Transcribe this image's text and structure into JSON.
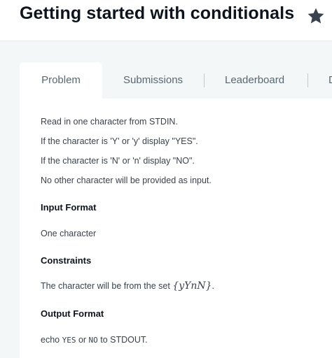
{
  "header": {
    "title": "Getting started with conditionals",
    "icon": "star-icon"
  },
  "tabs": [
    {
      "label": "Problem",
      "active": true
    },
    {
      "label": "Submissions",
      "active": false
    },
    {
      "label": "Leaderboard",
      "active": false
    },
    {
      "label": "D",
      "active": false
    }
  ],
  "problem": {
    "statement": [
      "Read in one character from STDIN.",
      "If the character is 'Y' or 'y' display \"YES\".",
      "If the character is 'N' or 'n' display \"NO\".",
      "No other character will be provided as input."
    ],
    "input_format": {
      "heading": "Input Format",
      "text": "One character"
    },
    "constraints": {
      "heading": "Constraints",
      "text_prefix": "The character will be from the set ",
      "set_open": "{",
      "set_body": "yYnN",
      "set_close": "}",
      "text_suffix": "."
    },
    "output_format": {
      "heading": "Output Format",
      "prefix": "echo ",
      "code1": "YES",
      "middle": " or ",
      "code2": "NO",
      "suffix": " to STDOUT."
    }
  },
  "colors": {
    "background": "#f3f7f7",
    "card": "#ffffff",
    "title": "#0e141e",
    "text": "#39424e",
    "tab_text": "#576871",
    "star": "#39424e"
  }
}
